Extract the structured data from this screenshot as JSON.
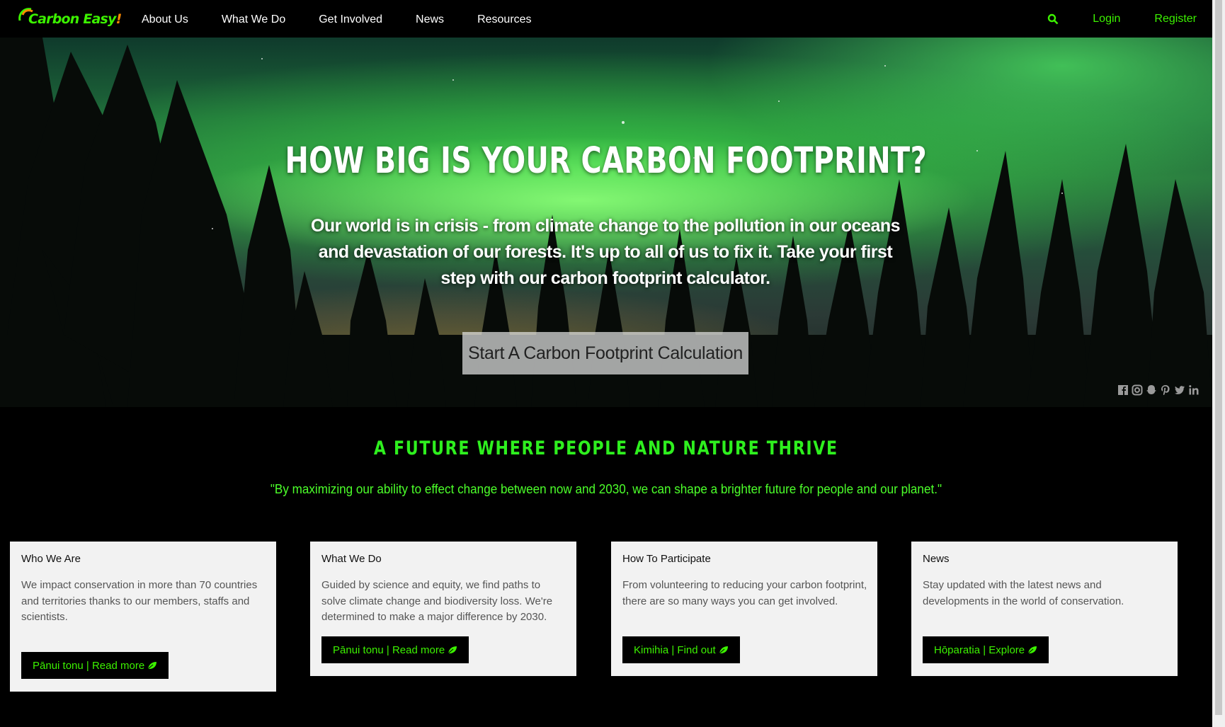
{
  "brand": {
    "name_main": "Carbon Easy",
    "name_bang": "!",
    "accent": "#3cf200",
    "orange": "#ff8a00"
  },
  "nav": {
    "links": [
      "About Us",
      "What We Do",
      "Get Involved",
      "News",
      "Resources"
    ],
    "search_icon": "search-icon",
    "login": "Login",
    "register": "Register"
  },
  "hero": {
    "title": "HOW BIG IS YOUR CARBON FOOTPRINT?",
    "text": "Our world is in crisis - from climate change to the pollution in our oceans and devastation of our forests. It's up to all of us to fix it. Take your first step with our carbon footprint calculator.",
    "cta": "Start A Carbon Footprint Calculation",
    "social_icons": [
      "facebook-icon",
      "instagram-icon",
      "snapchat-icon",
      "pinterest-icon",
      "twitter-icon",
      "linkedin-icon"
    ]
  },
  "mission": {
    "title": "A FUTURE WHERE PEOPLE AND NATURE THRIVE",
    "quote": "\"By maximizing our ability to effect change between now and 2030, we can shape a brighter future for people and our planet.\""
  },
  "cards": [
    {
      "title": "Who We Are",
      "text": "We impact conservation in more than 70 countries and territories thanks to our members, staffs and scientists.",
      "button": "Pānui tonu | Read more"
    },
    {
      "title": "What We Do",
      "text": "Guided by science and equity, we find paths to solve climate change and biodiversity loss. We're determined to make a major difference by 2030.",
      "button": "Pānui tonu | Read more"
    },
    {
      "title": "How To Participate",
      "text": "From volunteering to reducing your carbon footprint, there are so many ways you can get involved.",
      "button": "Kimihia | Find out"
    },
    {
      "title": "News",
      "text": "Stay updated with the latest news and developments in the world of conservation.",
      "button": "Hōparatia | Explore"
    }
  ]
}
